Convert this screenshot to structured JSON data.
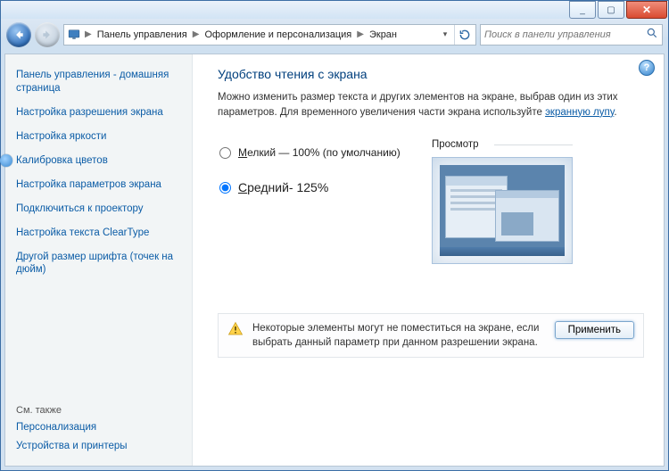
{
  "titlebar": {
    "min": "_",
    "max": "▢",
    "close": "✕"
  },
  "nav": {
    "back_icon": "back-arrow",
    "fwd_icon": "forward-arrow"
  },
  "breadcrumb": {
    "items": [
      "Панель управления",
      "Оформление и персонализация",
      "Экран"
    ]
  },
  "search": {
    "placeholder": "Поиск в панели управления"
  },
  "sidebar": {
    "items": [
      "Панель управления - домашняя страница",
      "Настройка разрешения экрана",
      "Настройка яркости",
      "Калибровка цветов",
      "Настройка параметров экрана",
      "Подключиться к проектору",
      "Настройка текста ClearType",
      "Другой размер шрифта (точек на дюйм)"
    ],
    "see_also_heading": "См. также",
    "see_also": [
      "Персонализация",
      "Устройства и принтеры"
    ]
  },
  "main": {
    "heading": "Удобство чтения с экрана",
    "description_pre": "Можно изменить размер текста и других элементов на экране, выбрав один из этих параметров. Для временного увеличения части экрана используйте ",
    "description_link": "экранную лупу",
    "description_post": ".",
    "option_small_letter": "М",
    "option_small_rest": "елкий — 100% (по умолчанию)",
    "option_medium_letter": "С",
    "option_medium_rest": "редний- 125%",
    "preview_label": "Просмотр",
    "warning": "Некоторые элементы могут не поместиться на экране, если выбрать данный параметр при данном разрешении экрана.",
    "apply": "Применить"
  },
  "help": "?"
}
